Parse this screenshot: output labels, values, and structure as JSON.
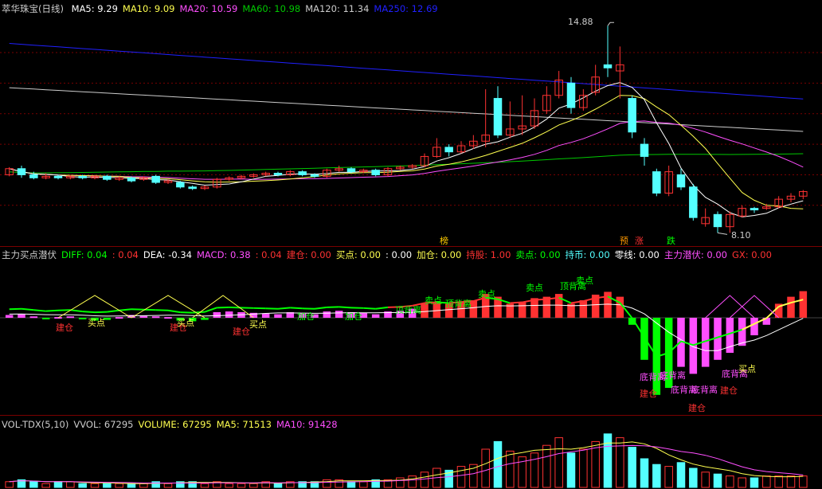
{
  "colors": {
    "bg": "#000000",
    "up": "#ff3232",
    "down": "#54ffff",
    "grid": "#7a0000",
    "ma5": "#ffffff",
    "ma10": "#ffff4f",
    "ma20": "#ff4fff",
    "ma60": "#00c800",
    "ma120": "#cccccc",
    "ma250": "#2020ff"
  },
  "price_panel": {
    "title": "萃华珠宝(日线)",
    "indicators": [
      {
        "label": "MA5: 9.29",
        "color": "#ffffff"
      },
      {
        "label": "MA10: 9.09",
        "color": "#ffff4f"
      },
      {
        "label": "MA20: 10.59",
        "color": "#ff4fff"
      },
      {
        "label": "MA60: 10.98",
        "color": "#00c800"
      },
      {
        "label": "MA120: 11.34",
        "color": "#cccccc"
      },
      {
        "label": "MA250: 12.69",
        "color": "#2020ff"
      }
    ],
    "high_label": "14.88",
    "low_label": "8.10",
    "flags": [
      {
        "text": "榜",
        "color": "#ffcc00"
      },
      {
        "text": "预",
        "color": "#ff9900"
      },
      {
        "text": "涨",
        "color": "#ff3232"
      },
      {
        "text": "跌",
        "color": "#00ff00"
      }
    ]
  },
  "macd_panel": {
    "indicators": [
      {
        "label": "主力买点潜伏",
        "color": "#cccccc"
      },
      {
        "label": "DIFF: 0.04",
        "color": "#00ff00"
      },
      {
        "label": ": 0.04",
        "color": "#ff3232"
      },
      {
        "label": "DEA: -0.34",
        "color": "#ffffff"
      },
      {
        "label": "MACD: 0.38",
        "color": "#ff4fff"
      },
      {
        "label": ": 0.04",
        "color": "#ff3232"
      },
      {
        "label": "建仓: 0.00",
        "color": "#ff3232"
      },
      {
        "label": "买点: 0.00",
        "color": "#ffff4f"
      },
      {
        "label": ": 0.00",
        "color": "#ffffff"
      },
      {
        "label": "加仓: 0.00",
        "color": "#ffff4f"
      },
      {
        "label": "持股: 1.00",
        "color": "#ff3232"
      },
      {
        "label": "卖点: 0.00",
        "color": "#00ff00"
      },
      {
        "label": "持币: 0.00",
        "color": "#54ffff"
      },
      {
        "label": "零线: 0.00",
        "color": "#ffffff"
      },
      {
        "label": "主力潜伏: 0.00",
        "color": "#ff4fff"
      },
      {
        "label": "GX: 0.00",
        "color": "#ff3232"
      }
    ],
    "signals": {
      "build": "建仓",
      "buy": "买点",
      "add": "加仓",
      "sell": "卖点",
      "top_div": "顶背离",
      "bottom_div": "底背离"
    }
  },
  "vol_panel": {
    "indicators": [
      {
        "label": "VOL-TDX(5,10)",
        "color": "#cccccc"
      },
      {
        "label": "VVOL: 67295",
        "color": "#cccccc"
      },
      {
        "label": "VOLUME: 67295",
        "color": "#ffff4f"
      },
      {
        "label": "MA5: 71513",
        "color": "#ffff4f"
      },
      {
        "label": "MA10: 91428",
        "color": "#ff4fff"
      }
    ]
  },
  "chart_data": {
    "type": "candlestick",
    "price_range": [
      7.9,
      15.2
    ],
    "candles": [
      [
        10.0,
        10.2,
        10.25,
        9.95
      ],
      [
        10.2,
        10.0,
        10.3,
        9.9
      ],
      [
        10.0,
        9.9,
        10.1,
        9.85
      ],
      [
        9.9,
        9.95,
        10.05,
        9.85
      ],
      [
        9.95,
        9.9,
        10.0,
        9.85
      ],
      [
        9.9,
        9.95,
        10.0,
        9.85
      ],
      [
        9.95,
        9.9,
        10.0,
        9.85
      ],
      [
        9.9,
        9.95,
        10.0,
        9.85
      ],
      [
        9.95,
        9.85,
        10.0,
        9.8
      ],
      [
        9.85,
        9.9,
        9.95,
        9.8
      ],
      [
        9.9,
        9.8,
        9.95,
        9.75
      ],
      [
        9.85,
        9.9,
        9.95,
        9.8
      ],
      [
        9.95,
        9.75,
        10.0,
        9.7
      ],
      [
        9.75,
        9.8,
        9.85,
        9.7
      ],
      [
        9.75,
        9.6,
        9.8,
        9.55
      ],
      [
        9.6,
        9.55,
        9.65,
        9.5
      ],
      [
        9.55,
        9.6,
        9.65,
        9.5
      ],
      [
        9.6,
        9.85,
        9.9,
        9.55
      ],
      [
        9.85,
        9.9,
        9.95,
        9.8
      ],
      [
        9.9,
        9.95,
        10.0,
        9.85
      ],
      [
        9.95,
        10.0,
        10.05,
        9.9
      ],
      [
        10.0,
        10.05,
        10.1,
        9.95
      ],
      [
        10.05,
        10.0,
        10.1,
        9.95
      ],
      [
        10.0,
        10.1,
        10.15,
        9.95
      ],
      [
        10.1,
        10.0,
        10.15,
        9.95
      ],
      [
        10.0,
        9.95,
        10.05,
        9.9
      ],
      [
        9.95,
        10.15,
        10.2,
        9.9
      ],
      [
        10.15,
        10.2,
        10.3,
        10.1
      ],
      [
        10.2,
        10.1,
        10.25,
        10.05
      ],
      [
        10.1,
        10.15,
        10.2,
        10.05
      ],
      [
        10.15,
        10.0,
        10.2,
        9.95
      ],
      [
        10.0,
        10.2,
        10.25,
        9.95
      ],
      [
        10.2,
        10.25,
        10.3,
        10.15
      ],
      [
        10.25,
        10.3,
        10.35,
        10.2
      ],
      [
        10.3,
        10.6,
        10.7,
        10.25
      ],
      [
        10.6,
        10.9,
        11.2,
        10.55
      ],
      [
        10.9,
        10.75,
        11.0,
        10.6
      ],
      [
        10.75,
        10.95,
        11.1,
        10.7
      ],
      [
        10.95,
        11.1,
        11.3,
        10.85
      ],
      [
        11.1,
        11.3,
        12.8,
        10.9
      ],
      [
        12.5,
        11.3,
        12.9,
        11.2
      ],
      [
        11.3,
        11.5,
        12.4,
        11.2
      ],
      [
        11.5,
        11.6,
        12.6,
        11.3
      ],
      [
        11.6,
        12.1,
        12.5,
        11.5
      ],
      [
        12.1,
        12.6,
        12.9,
        12.0
      ],
      [
        12.6,
        13.1,
        13.4,
        12.5
      ],
      [
        13.0,
        12.2,
        13.2,
        12.0
      ],
      [
        12.2,
        12.6,
        12.8,
        12.1
      ],
      [
        12.7,
        13.2,
        13.6,
        12.6
      ],
      [
        13.6,
        13.5,
        14.88,
        13.2
      ],
      [
        13.4,
        13.6,
        14.2,
        12.5
      ],
      [
        12.5,
        11.4,
        12.6,
        11.2
      ],
      [
        11.0,
        10.6,
        11.2,
        10.3
      ],
      [
        10.1,
        9.4,
        10.2,
        9.3
      ],
      [
        9.4,
        10.1,
        10.3,
        9.3
      ],
      [
        10.0,
        9.6,
        10.2,
        9.5
      ],
      [
        9.6,
        8.6,
        9.7,
        8.5
      ],
      [
        8.4,
        8.6,
        8.9,
        8.3
      ],
      [
        8.7,
        8.3,
        8.8,
        8.1
      ],
      [
        8.3,
        8.7,
        8.8,
        8.1
      ],
      [
        8.65,
        8.9,
        9.0,
        8.6
      ],
      [
        8.9,
        8.85,
        8.95,
        8.75
      ],
      [
        8.9,
        8.95,
        9.05,
        8.85
      ],
      [
        8.95,
        9.2,
        9.3,
        8.9
      ],
      [
        9.2,
        9.3,
        9.4,
        9.1
      ],
      [
        9.3,
        9.45,
        9.5,
        9.2
      ]
    ],
    "macd": [
      0.04,
      0.05,
      0.02,
      -0.01,
      0.01,
      0.02,
      -0.02,
      -0.04,
      -0.03,
      0.01,
      0.04,
      0.03,
      0.02,
      0.01,
      -0.04,
      -0.05,
      -0.03,
      0.08,
      0.09,
      0.08,
      0.07,
      0.06,
      0.05,
      0.08,
      0.06,
      0.05,
      0.09,
      0.1,
      0.08,
      0.07,
      0.05,
      0.09,
      0.1,
      0.13,
      0.2,
      0.22,
      0.2,
      0.23,
      0.25,
      0.34,
      0.3,
      0.2,
      0.22,
      0.28,
      0.3,
      0.34,
      0.2,
      0.25,
      0.33,
      0.37,
      0.3,
      -0.1,
      -0.6,
      -1.1,
      -1.0,
      -0.7,
      -0.8,
      -0.7,
      -0.6,
      -0.5,
      -0.4,
      -0.25,
      -0.1,
      0.2,
      0.3,
      0.38
    ],
    "volume": [
      3,
      4,
      3,
      2,
      3,
      3,
      2,
      2,
      2,
      2,
      2,
      2,
      3,
      2,
      3,
      3,
      2,
      3,
      2,
      2,
      2,
      3,
      2,
      3,
      3,
      3,
      4,
      4,
      3,
      3,
      4,
      4,
      5,
      6,
      8,
      10,
      9,
      11,
      12,
      20,
      24,
      19,
      16,
      18,
      22,
      26,
      18,
      20,
      24,
      28,
      26,
      21,
      15,
      12,
      11,
      13,
      10,
      8,
      7,
      6,
      5,
      5,
      6,
      6,
      6,
      6
    ],
    "volume_range": [
      0,
      30
    ]
  }
}
